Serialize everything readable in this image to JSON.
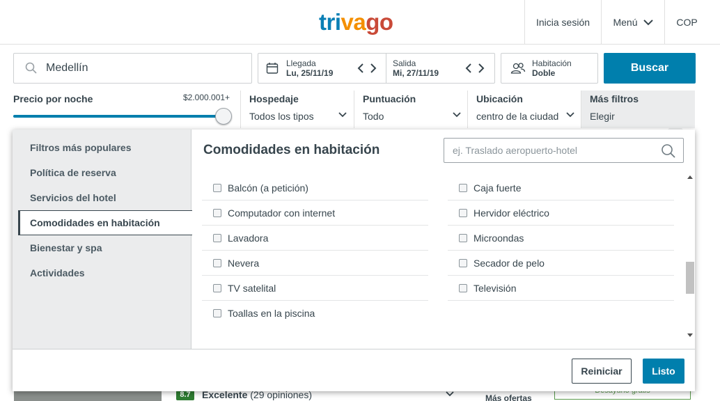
{
  "header": {
    "logo": {
      "part1": "tri",
      "part2": "va",
      "part3": "go"
    },
    "login": "Inicia sesión",
    "menu": "Menú",
    "currency": "COP"
  },
  "search": {
    "destination": "Medellín",
    "checkin_label": "Llegada",
    "checkin_value": "Lu, 25/11/19",
    "checkout_label": "Salida",
    "checkout_value": "Mi, 27/11/19",
    "room_label": "Habitación",
    "room_value": "Doble",
    "button": "Buscar"
  },
  "filters": {
    "price_label": "Precio por noche",
    "price_max": "$2.000.001+",
    "price_slider_position": 1.0,
    "items": [
      {
        "title": "Hospedaje",
        "value": "Todos los tipos"
      },
      {
        "title": "Puntuación",
        "value": "Todo"
      },
      {
        "title": "Ubicación",
        "value": "centro de la ciudad"
      },
      {
        "title": "Más filtros",
        "value": "Elegir"
      }
    ]
  },
  "panel": {
    "categories": [
      "Filtros más populares",
      "Política de reserva",
      "Servicios del hotel",
      "Comodidades en habitación",
      "Bienestar y spa",
      "Actividades"
    ],
    "active_category_index": 3,
    "title": "Comodidades en habitación",
    "search_placeholder": "ej. Traslado aeropuerto-hotel",
    "left_options": [
      "Balcón (a petición)",
      "Computador con internet",
      "Lavadora",
      "Nevera",
      "TV satelital",
      "Toallas en la piscina"
    ],
    "right_options": [
      "Caja fuerte",
      "Hervidor eléctrico",
      "Microondas",
      "Secador de pelo",
      "Televisión"
    ],
    "reset": "Reiniciar",
    "done": "Listo"
  },
  "peek": {
    "score": "8.7",
    "rating_word": "Excelente",
    "reviews": "(29 opiniones)",
    "offers": "Más ofertas",
    "deal": "Desayuno gratis"
  },
  "colors": {
    "accent": "#007fad",
    "logo_blue": "#0a7fb5",
    "logo_orange": "#f48f00",
    "logo_red": "#c94a38"
  }
}
